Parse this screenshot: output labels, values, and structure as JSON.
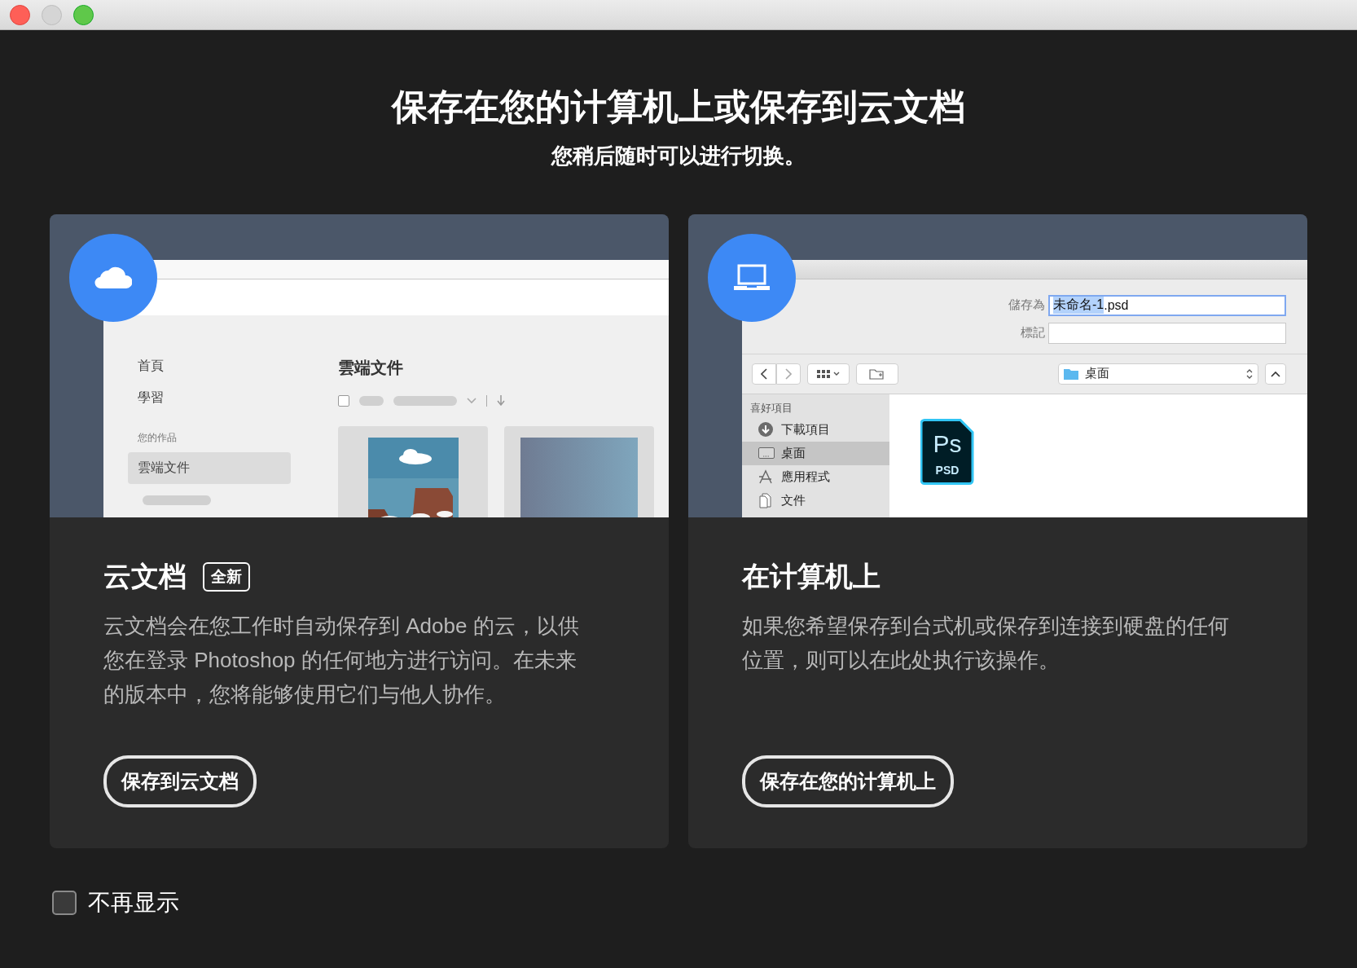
{
  "window_buttons": [
    {
      "kind": "close",
      "color": "#fe5f57"
    },
    {
      "kind": "minimize",
      "color": "#d5d5d5"
    },
    {
      "kind": "zoom",
      "color": "#5fc84a"
    }
  ],
  "title": "保存在您的计算机上或保存到云文档",
  "subtitle": "您稍后随时可以进行切换。",
  "options": [
    {
      "kind": "cloud",
      "preview": {
        "sidebar": [
          {
            "label": "首頁",
            "kind": "link",
            "selected": false
          },
          {
            "label": "學習",
            "kind": "link",
            "selected": false
          },
          {
            "label": "您的作品",
            "kind": "section",
            "selected": false
          },
          {
            "label": "雲端文件",
            "kind": "link",
            "selected": true
          }
        ],
        "heading": "雲端文件",
        "select_all": {
          "checked": false
        },
        "thumbnails": [
          {
            "kind": "picture"
          },
          {
            "kind": "gradient"
          }
        ]
      },
      "heading": "云文档",
      "badge": "全新",
      "description": "云文档会在您工作时自动保存到 Adobe 的云，以供您在登录 Photoshop 的任何地方进行访问。在未来的版本中，您将能够使用它们与他人协作。",
      "button": "保存到云文档"
    },
    {
      "kind": "computer",
      "preview": {
        "fields": [
          {
            "label": "儲存為",
            "parts": [
              {
                "text": "未命名-1",
                "selected": true
              },
              {
                "text": ".psd",
                "selected": false
              }
            ],
            "focused": true
          },
          {
            "label": "標記",
            "focused": false
          }
        ],
        "location": "桌面",
        "sidebar_heading": "喜好項目",
        "sidebar": [
          {
            "label": "下載項目",
            "kind": "download",
            "selected": false
          },
          {
            "label": "桌面",
            "kind": "desktop",
            "selected": true
          },
          {
            "label": "應用程式",
            "kind": "apps",
            "selected": false
          },
          {
            "label": "文件",
            "kind": "documents",
            "selected": false
          }
        ],
        "files": [
          {
            "kind": "psd",
            "title": "Ps",
            "label": "PSD"
          }
        ]
      },
      "heading": "在计算机上",
      "description": "如果您希望保存到台式机或保存到连接到硬盘的任何位置，则可以在此处执行该操作。",
      "button": "保存在您的计算机上"
    }
  ],
  "dont_show_again": {
    "label": "不再显示",
    "checked": false
  }
}
